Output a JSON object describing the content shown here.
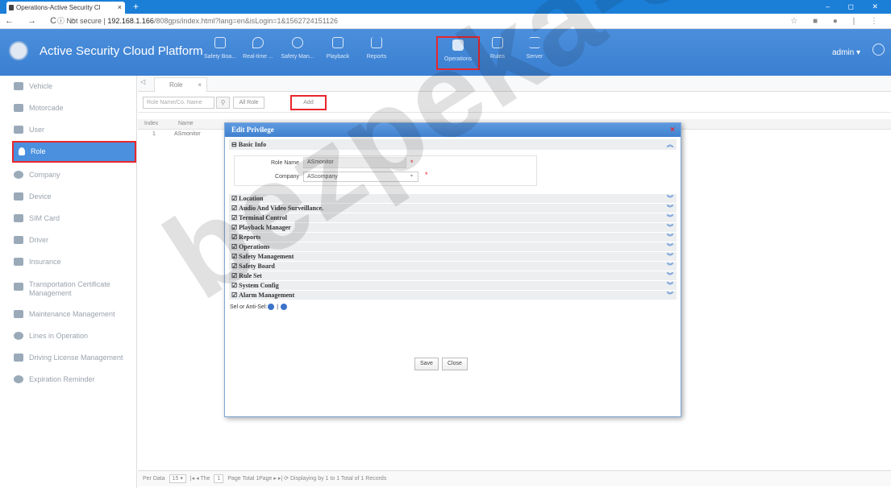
{
  "browser": {
    "tab_title": "Operations-Active Security Cl",
    "tab_close": "×",
    "new_tab": "+",
    "nav": "← → C ⌂",
    "url_prefix": "ⓘ Not secure |",
    "url_host": "192.168.1.166",
    "url_path": "/808gps/index.html?lang=en&isLogin=1&1562724151126",
    "window_controls": "– ◻ ✕",
    "ext_icons": "☆ ■ ● | ⋮"
  },
  "header": {
    "title": "Active Security Cloud Platform",
    "nav": [
      {
        "label": "Safety Boa..."
      },
      {
        "label": "Real-time ..."
      },
      {
        "label": "Safety Man..."
      },
      {
        "label": "Playback"
      },
      {
        "label": "Reports"
      },
      {
        "label": "Operations"
      },
      {
        "label": "Rules"
      },
      {
        "label": "Server"
      }
    ],
    "user": "admin ▾"
  },
  "sidebar": {
    "items": [
      {
        "label": "Vehicle"
      },
      {
        "label": "Motorcade"
      },
      {
        "label": "User"
      },
      {
        "label": "Role"
      },
      {
        "label": "Company"
      },
      {
        "label": "Device"
      },
      {
        "label": "SIM Card"
      },
      {
        "label": "Driver"
      },
      {
        "label": "Insurance"
      },
      {
        "label": "Transportation Certificate Management"
      },
      {
        "label": "Maintenance Management"
      },
      {
        "label": "Lines in Operation"
      },
      {
        "label": "Driving License Management"
      },
      {
        "label": "Expiration Reminder"
      }
    ],
    "active": "Role"
  },
  "content": {
    "back": "◁",
    "tab": "Role",
    "tab_close": "×",
    "search_placeholder": "Role Name/Co. Name",
    "search_icon": "⚲",
    "all_role": "All Role",
    "add": "Add",
    "columns": [
      "Index",
      "Name"
    ],
    "rows": [
      {
        "index": "1",
        "name": "ASmonitor"
      }
    ],
    "pager": {
      "per_data_label": "Per Data",
      "per_data_value": "15",
      "page_label": "The",
      "page_value": "1",
      "page_total": "Page  Total 1Page",
      "status": "Displaying by 1 to 1 Total of 1 Records"
    }
  },
  "dialog": {
    "title": "Edit  Privilege",
    "close": "×",
    "basic_info": "Basic Info",
    "role_name_label": "Role Name",
    "role_name_value": "ASmonitor",
    "company_label": "Company",
    "company_value": "AScompany",
    "required": "*",
    "sections": [
      "Location",
      "Audio And Video Surveillance.",
      "Terminal Control",
      "Playback Manager",
      "Reports",
      "Operations",
      "Safety Management",
      "Safety Board",
      "Rule Set",
      "System Config",
      "Alarm Management"
    ],
    "sel_anti": "Sel or Anti-Sel:",
    "save": "Save",
    "close_btn": "Close"
  },
  "watermark": "bezpeka-sh",
  "colors": {
    "header": "#3a7fd1",
    "active": "#4a90de",
    "highlight": "#e8262c"
  }
}
